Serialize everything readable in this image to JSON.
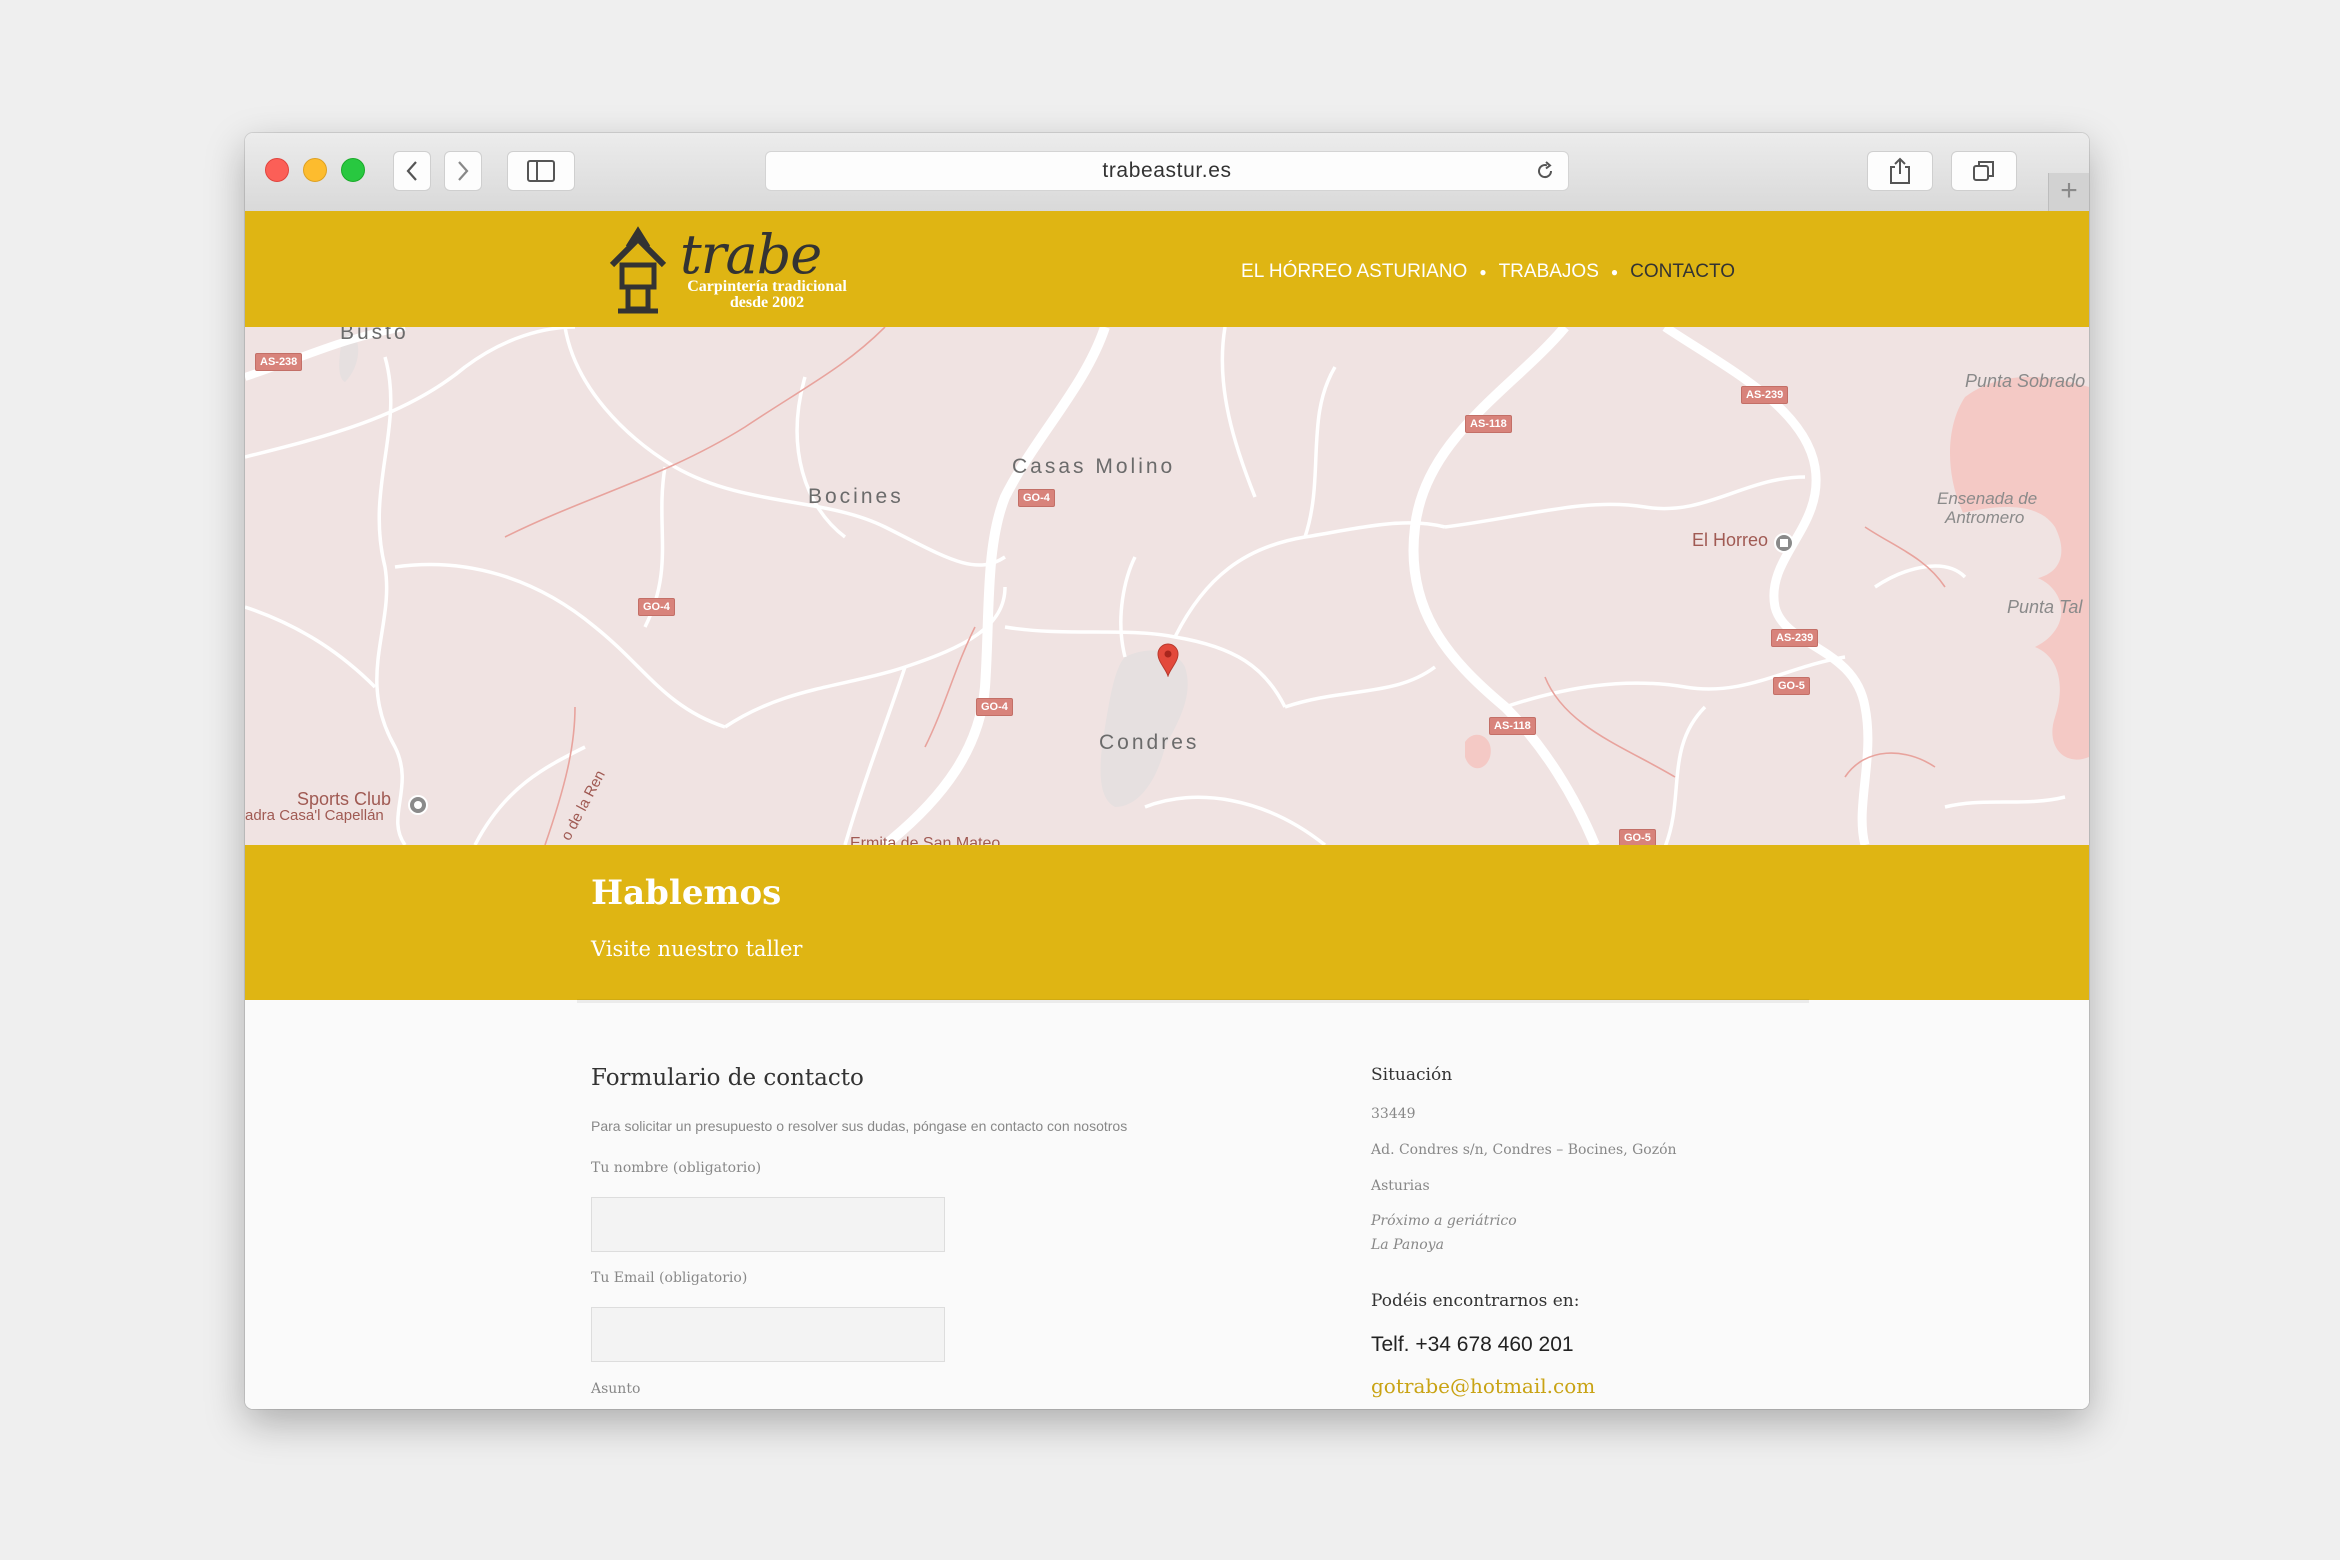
{
  "browser": {
    "url": "trabeastur.es",
    "icons": {
      "back": "chevron-left-icon",
      "forward": "chevron-right-icon",
      "sidebar": "sidebar-icon",
      "reload": "reload-icon",
      "share": "share-icon",
      "tabs": "tabs-icon",
      "new_tab": "plus-icon"
    }
  },
  "header": {
    "brand_color": "#dfb513",
    "logo_word": "trabe",
    "logo_tagline_1": "Carpintería tradicional",
    "logo_tagline_2": "desde 2002",
    "nav": [
      {
        "label": "EL HÓRREO ASTURIANO"
      },
      {
        "label": "TRABAJOS"
      },
      {
        "label": "CONTACTO",
        "active": true
      }
    ]
  },
  "map": {
    "places": [
      "Busto",
      "Bocines",
      "Casas Molino",
      "Condres"
    ],
    "pois": [
      "Sports Club",
      "adra Casa'l Capellán",
      "El Horreo",
      "Ermita de San Mateo",
      "o de la Ren"
    ],
    "water": [
      "Punta Sobrado",
      "Ensenada de",
      "Antromero",
      "Punta Tal"
    ],
    "shields": [
      "AS-238",
      "GO-4",
      "GO-4",
      "GO-4",
      "AS-118",
      "AS-118",
      "AS-239",
      "AS-239",
      "GO-5",
      "GO-5"
    ],
    "marker": "map-pin-icon"
  },
  "banner": {
    "title": "Hablemos",
    "subtitle": "Visite nuestro taller"
  },
  "form": {
    "title": "Formulario de contacto",
    "description": "Para solicitar un presupuesto o resolver sus dudas, póngase en contacto con nosotros",
    "name_label": "Tu nombre (obligatorio)",
    "email_label": "Tu Email (obligatorio)",
    "subject_label": "Asunto",
    "name_value": "",
    "email_value": ""
  },
  "sidebar": {
    "situation_title": "Situación",
    "postal_code": "33449",
    "address": "Ad. Condres s/n, Condres – Bocines, Gozón",
    "region": "Asturias",
    "near_1": "Próximo a geriátrico",
    "near_2": "La Panoya",
    "find_us": "Podéis encontrarnos en:",
    "phone": "Telf. +34 678 460 201",
    "email": "gotrabe@hotmail.com"
  }
}
